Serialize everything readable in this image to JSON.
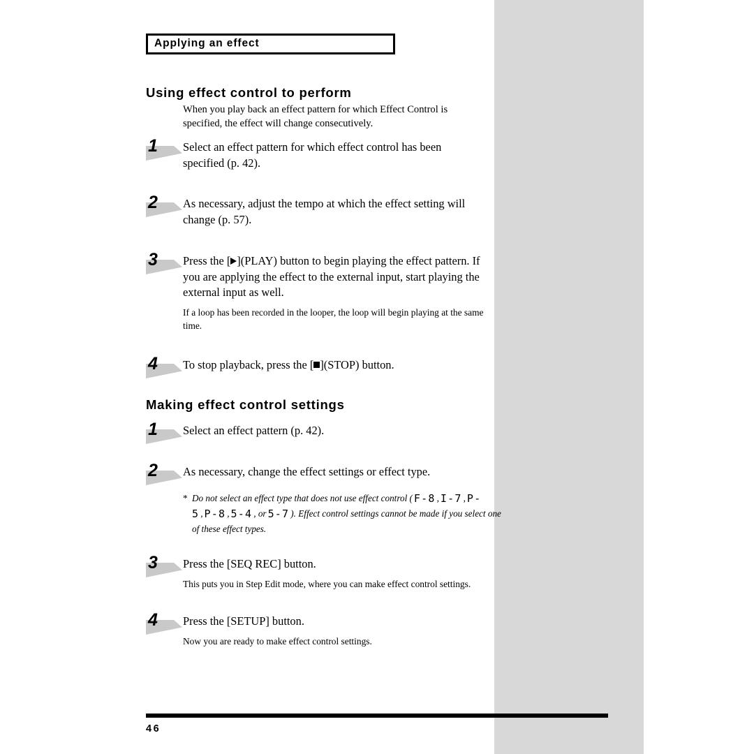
{
  "page": {
    "number": "46",
    "chapter_title": "Applying an effect"
  },
  "sections": [
    {
      "heading": "Using effect control to perform",
      "lead": "When you play back an effect pattern for which Effect Control is specified, the effect will change consecutively.",
      "steps": [
        {
          "number": "1",
          "main_before": "Select an effect pattern for which effect control has been specified (p. 42).",
          "note": ""
        },
        {
          "number": "2",
          "main_before": "As necessary, adjust the tempo at which the effect setting will change (p. 57).",
          "note": ""
        },
        {
          "number": "3",
          "main_before": "Press the [",
          "glyph": "play-icon",
          "main_after": "](PLAY) button to begin playing the effect pattern. If you are applying the effect to the external input, start playing the external input as well.",
          "note": "If a loop has been recorded in the looper, the loop will begin playing at the same time."
        },
        {
          "number": "4",
          "main_before": "To stop playback, press the [",
          "glyph": "stop-icon",
          "main_after": "](STOP) button.",
          "note": ""
        }
      ]
    },
    {
      "heading": "Making effect control settings",
      "lead": "",
      "steps": [
        {
          "number": "1",
          "main_before": "Select an effect pattern (p. 42).",
          "note": ""
        },
        {
          "number": "2",
          "main_before": "As necessary, change the effect settings or effect type.",
          "note": ""
        },
        {
          "number": "3",
          "main_before": "Press the [SEQ REC] button.",
          "note": "This puts you in Step Edit mode, where you can make effect control settings."
        },
        {
          "number": "4",
          "main_before": "Press the [SETUP] button.",
          "note": "Now you are ready to make effect control settings."
        }
      ]
    }
  ],
  "footnote": {
    "asterisk": "*",
    "text_part1": "Do not select an effect type that does not use effect control (",
    "codes": [
      "F-8",
      "I-7",
      "P-5",
      "P-8",
      "5-4",
      "5-7"
    ],
    "separator": ",",
    "conjunction": "or",
    "text_part2": "). Effect control settings cannot be made if you select one of these effect types."
  },
  "colors": {
    "ink": "#000000",
    "paper": "#ffffff",
    "gray_band": "#d8d8d8",
    "marker_flag": "#c9c9c9"
  }
}
